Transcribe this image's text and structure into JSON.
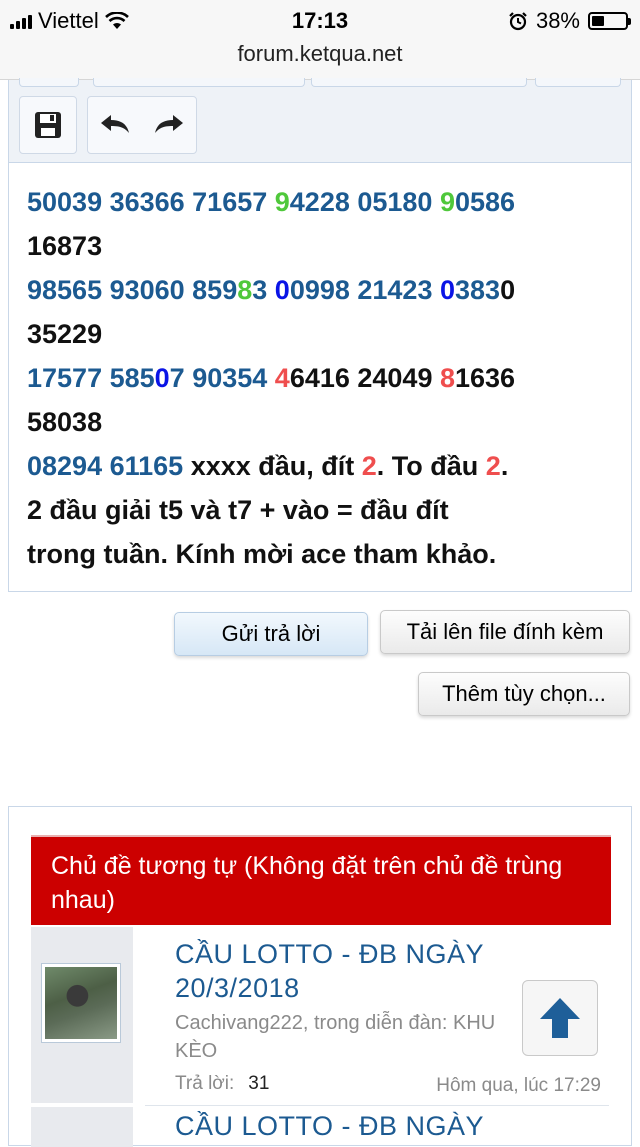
{
  "status_bar": {
    "carrier": "Viettel",
    "time": "17:13",
    "battery": "38%",
    "battery_level": 0.38
  },
  "browser": {
    "url": "forum.ketqua.net"
  },
  "editor": {
    "toolbar": {
      "save_icon": "floppy-disk-icon",
      "undo_icon": "undo-arrow-icon",
      "redo_icon": "redo-arrow-icon"
    },
    "lines": [
      [
        {
          "t": "50039 36366 71657 ",
          "c": "n"
        },
        {
          "t": "9",
          "c": "g"
        },
        {
          "t": "4228 05180 ",
          "c": "n"
        },
        {
          "t": "9",
          "c": "g"
        },
        {
          "t": "0586",
          "c": "n"
        }
      ],
      [
        {
          "t": "16873",
          "c": "k"
        }
      ],
      [
        {
          "t": "98565 93060 859",
          "c": "n"
        },
        {
          "t": "8",
          "c": "g"
        },
        {
          "t": "3 ",
          "c": "n"
        },
        {
          "t": "0",
          "c": "b"
        },
        {
          "t": "0998 21423 ",
          "c": "n"
        },
        {
          "t": "0",
          "c": "b"
        },
        {
          "t": "383",
          "c": "n"
        },
        {
          "t": "0",
          "c": "k"
        }
      ],
      [
        {
          "t": "35229",
          "c": "k"
        }
      ],
      [
        {
          "t": "17577 585",
          "c": "n"
        },
        {
          "t": "0",
          "c": "b"
        },
        {
          "t": "7 90354 ",
          "c": "n"
        },
        {
          "t": "4",
          "c": "r"
        },
        {
          "t": "6416 24049 ",
          "c": "k"
        },
        {
          "t": "8",
          "c": "r"
        },
        {
          "t": "1636",
          "c": "k"
        }
      ],
      [
        {
          "t": "58038",
          "c": "k"
        }
      ],
      [
        {
          "t": "08294 61165 ",
          "c": "n"
        },
        {
          "t": "xxxx đầu, đít ",
          "c": "k"
        },
        {
          "t": "2",
          "c": "r"
        },
        {
          "t": ". To đầu ",
          "c": "k"
        },
        {
          "t": "2",
          "c": "r"
        },
        {
          "t": ".",
          "c": "k"
        }
      ],
      [
        {
          "t": "2 đầu giải t5 và t7 + vào = đầu đít",
          "c": "k"
        }
      ],
      [
        {
          "t": "trong tuần. Kính mời ace tham khảo.",
          "c": "k"
        }
      ]
    ]
  },
  "actions": {
    "reply": "Gửi trả lời",
    "upload": "Tải lên file đính kèm",
    "more_options": "Thêm tùy chọn..."
  },
  "similar_threads": {
    "heading": "Chủ đề tương tự (Không đặt trên chủ đề trùng nhau)",
    "threads": [
      {
        "title_line1": "CẦU LOTTO - ĐB NGÀY",
        "title_line2": "20/3/2018",
        "meta_line1": "Cachivang222, trong diễn đàn: KHU",
        "meta_line2": "KÈO",
        "replies_label": "Trả lời:",
        "replies": "31",
        "date": "Hôm qua, lúc 17:29"
      },
      {
        "title_line1": "CẦU LOTTO - ĐB NGÀY"
      }
    ]
  },
  "scroll_top_icon": "arrow-up-icon",
  "colors": {
    "header_red": "#cc0000",
    "link_blue": "#1c5a91",
    "green": "#4fc83b",
    "blue": "#0a14e6",
    "red": "#ef4e4e"
  }
}
